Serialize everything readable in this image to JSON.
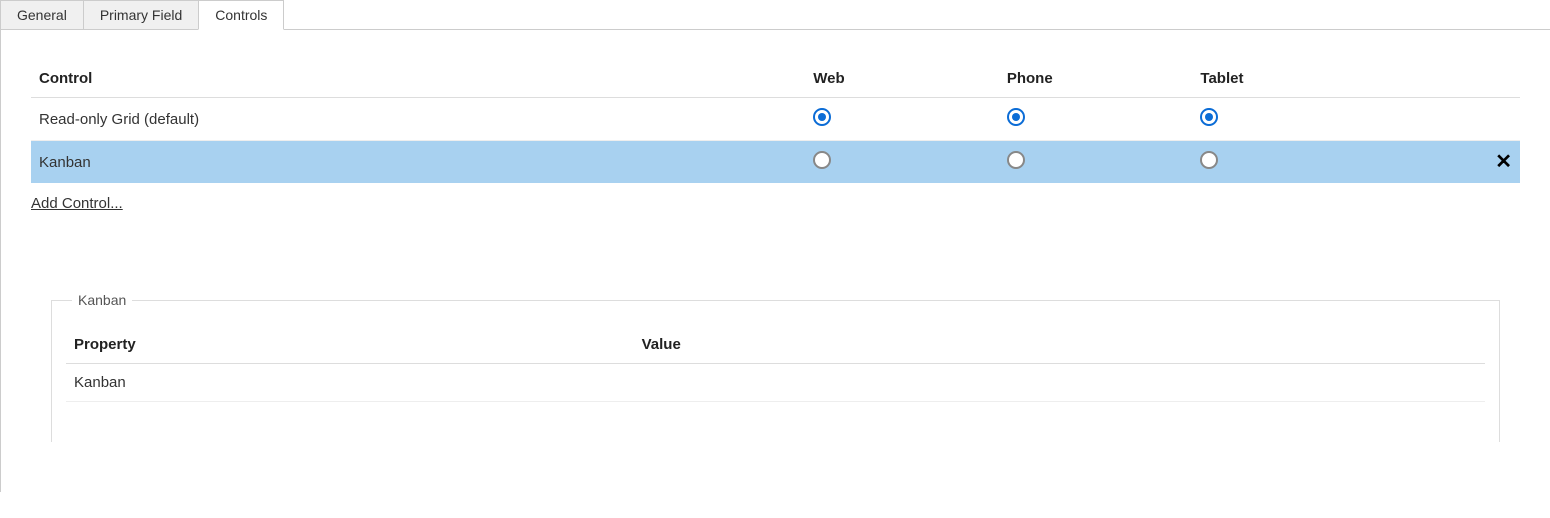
{
  "tabs": [
    {
      "label": "General",
      "active": false
    },
    {
      "label": "Primary Field",
      "active": false
    },
    {
      "label": "Controls",
      "active": true
    }
  ],
  "controlsTable": {
    "headers": {
      "control": "Control",
      "web": "Web",
      "phone": "Phone",
      "tablet": "Tablet"
    },
    "rows": [
      {
        "name": "Read-only Grid (default)",
        "web": true,
        "phone": true,
        "tablet": true,
        "selected": false,
        "removable": false
      },
      {
        "name": "Kanban",
        "web": false,
        "phone": false,
        "tablet": false,
        "selected": true,
        "removable": true
      }
    ]
  },
  "addControlLink": "Add Control...",
  "detailPanel": {
    "legend": "Kanban",
    "headers": {
      "property": "Property",
      "value": "Value"
    },
    "rows": [
      {
        "property": "Kanban",
        "value": ""
      }
    ]
  }
}
